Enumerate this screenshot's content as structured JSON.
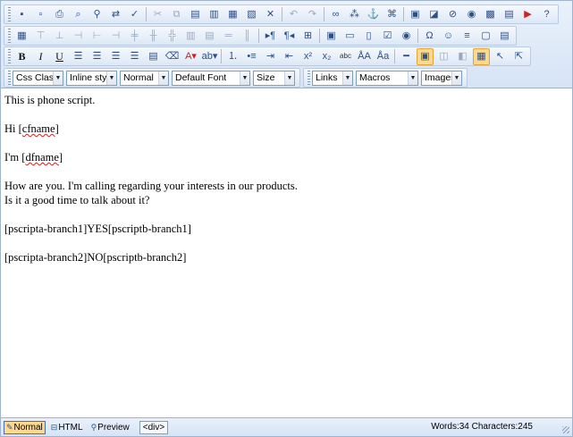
{
  "toolbar": {
    "row1": [
      {
        "name": "save-icon",
        "glyph": "▪"
      },
      {
        "name": "new-document-icon",
        "glyph": "▫"
      },
      {
        "name": "print-icon",
        "glyph": "⎙"
      },
      {
        "name": "preview-icon",
        "glyph": "⌕"
      },
      {
        "name": "find-icon",
        "glyph": "⚲"
      },
      {
        "name": "replace-icon",
        "glyph": "⇄"
      },
      {
        "name": "spellcheck-icon",
        "glyph": "✓"
      },
      {
        "sep": true
      },
      {
        "name": "cut-icon",
        "glyph": "✂",
        "dim": true
      },
      {
        "name": "copy-icon",
        "glyph": "⧉",
        "dim": true
      },
      {
        "name": "paste-icon",
        "glyph": "▤"
      },
      {
        "name": "paste-text-icon",
        "glyph": "▥"
      },
      {
        "name": "paste-word-icon",
        "glyph": "▦"
      },
      {
        "name": "paste-html-icon",
        "glyph": "▧"
      },
      {
        "name": "delete-icon",
        "glyph": "✕"
      },
      {
        "sep": true
      },
      {
        "name": "undo-icon",
        "glyph": "↶",
        "dim": true
      },
      {
        "name": "redo-icon",
        "glyph": "↷",
        "dim": true
      },
      {
        "sep": true
      },
      {
        "name": "insert-link-icon",
        "glyph": "∞"
      },
      {
        "name": "unlink-icon",
        "glyph": "⁂"
      },
      {
        "name": "anchor-icon",
        "glyph": "⚓"
      },
      {
        "name": "link-tree-icon",
        "glyph": "⌘"
      },
      {
        "sep": true
      },
      {
        "name": "insert-image-icon",
        "glyph": "▣"
      },
      {
        "name": "image-editor-icon",
        "glyph": "◪"
      },
      {
        "name": "flash-icon",
        "glyph": "⊘"
      },
      {
        "name": "media-icon",
        "glyph": "◉"
      },
      {
        "name": "document-icon",
        "glyph": "▩"
      },
      {
        "name": "template-icon",
        "glyph": "▤"
      },
      {
        "name": "youtube-icon",
        "glyph": "▶",
        "red": true
      },
      {
        "name": "help-icon",
        "glyph": "?"
      }
    ],
    "row2": [
      {
        "name": "insert-table-icon",
        "glyph": "▦"
      },
      {
        "name": "insert-row-above-icon",
        "glyph": "⊤",
        "dim": true
      },
      {
        "name": "insert-row-below-icon",
        "glyph": "⊥",
        "dim": true
      },
      {
        "name": "delete-row-icon",
        "glyph": "⊣",
        "dim": true
      },
      {
        "name": "insert-column-left-icon",
        "glyph": "⊢",
        "dim": true
      },
      {
        "name": "insert-column-right-icon",
        "glyph": "⊣",
        "dim": true
      },
      {
        "name": "delete-column-icon",
        "glyph": "╪",
        "dim": true
      },
      {
        "name": "merge-cells-icon",
        "glyph": "╫",
        "dim": true
      },
      {
        "name": "split-cells-icon",
        "glyph": "╬",
        "dim": true
      },
      {
        "name": "cell-props-icon",
        "glyph": "▥",
        "dim": true
      },
      {
        "name": "table-props-icon",
        "glyph": "▤",
        "dim": true
      },
      {
        "name": "row-props-icon",
        "glyph": "═",
        "dim": true
      },
      {
        "name": "column-props-icon",
        "glyph": "║",
        "dim": true
      },
      {
        "sep": true
      },
      {
        "name": "ltr-icon",
        "glyph": "▸¶"
      },
      {
        "name": "rtl-icon",
        "glyph": "¶◂"
      },
      {
        "name": "show-borders-icon",
        "glyph": "⊞"
      },
      {
        "sep": true
      },
      {
        "name": "form-icon",
        "glyph": "▣"
      },
      {
        "name": "textbox-icon",
        "glyph": "▭"
      },
      {
        "name": "textarea-icon",
        "glyph": "▯"
      },
      {
        "name": "checkbox-icon",
        "glyph": "☑"
      },
      {
        "name": "radio-icon",
        "glyph": "◉"
      },
      {
        "sep": true
      },
      {
        "name": "special-char-icon",
        "glyph": "Ω"
      },
      {
        "name": "emoticon-icon",
        "glyph": "☺"
      },
      {
        "name": "code-snippet-icon",
        "glyph": "≡"
      },
      {
        "name": "insert-box-icon",
        "glyph": "▢"
      },
      {
        "name": "date-icon",
        "glyph": "▤"
      }
    ],
    "row3": [
      {
        "name": "bold-icon",
        "glyph": "B",
        "style": "bold"
      },
      {
        "name": "italic-icon",
        "glyph": "I",
        "style": "ital"
      },
      {
        "name": "underline-icon",
        "glyph": "U",
        "style": "under"
      },
      {
        "name": "align-left-icon",
        "glyph": "☰"
      },
      {
        "name": "align-center-icon",
        "glyph": "☰"
      },
      {
        "name": "align-right-icon",
        "glyph": "☰"
      },
      {
        "name": "align-justify-icon",
        "glyph": "☰"
      },
      {
        "name": "align-none-icon",
        "glyph": "▤"
      },
      {
        "name": "eraser-icon",
        "glyph": "⌫"
      },
      {
        "name": "font-color-icon",
        "glyph": "A▾",
        "red": true
      },
      {
        "name": "highlight-color-icon",
        "glyph": "ab▾"
      },
      {
        "sep": true
      },
      {
        "name": "ordered-list-icon",
        "glyph": "⒈"
      },
      {
        "name": "unordered-list-icon",
        "glyph": "•≡"
      },
      {
        "name": "indent-icon",
        "glyph": "⇥"
      },
      {
        "name": "outdent-icon",
        "glyph": "⇤"
      },
      {
        "name": "superscript-icon",
        "glyph": "x²"
      },
      {
        "name": "subscript-icon",
        "glyph": "x₂"
      },
      {
        "name": "strikethrough-icon",
        "glyph": "abc",
        "tiny": true
      },
      {
        "name": "uppercase-icon",
        "glyph": "ÅA"
      },
      {
        "name": "lowercase-icon",
        "glyph": "Åa"
      },
      {
        "sep": true
      },
      {
        "name": "horizontal-rule-icon",
        "glyph": "━"
      },
      {
        "name": "insert-layer-icon",
        "glyph": "▣",
        "active": true
      },
      {
        "name": "bring-forward-icon",
        "glyph": "◫",
        "dim": true
      },
      {
        "name": "send-backward-icon",
        "glyph": "◧",
        "dim": true
      },
      {
        "name": "show-grid-icon",
        "glyph": "▦",
        "active": true
      },
      {
        "name": "select-icon",
        "glyph": "↖"
      },
      {
        "name": "pointer-icon",
        "glyph": "⇱"
      }
    ],
    "dropdowns1": [
      {
        "name": "css-class-dropdown",
        "value": "Css Class",
        "width": 57
      },
      {
        "name": "inline-style-dropdown",
        "value": "Inline style",
        "width": 57
      },
      {
        "name": "paragraph-dropdown",
        "value": "Normal",
        "width": 55
      },
      {
        "name": "font-dropdown",
        "value": "Default Font",
        "width": 88
      },
      {
        "name": "size-dropdown",
        "value": "Size",
        "width": 47
      }
    ],
    "dropdowns2": [
      {
        "name": "links-dropdown",
        "value": "Links",
        "width": 46
      },
      {
        "name": "macros-dropdown",
        "value": "Macros",
        "width": 70
      },
      {
        "name": "images-dropdown",
        "value": "Images",
        "width": 46
      }
    ]
  },
  "content": {
    "line1": "This is phone script.",
    "line2_prefix": "Hi [",
    "line2_word": "cfname",
    "line2_suffix": "]",
    "line3_prefix": "I'm [",
    "line3_word": "dfname",
    "line3_suffix": "]",
    "line4a": "How are you. I'm calling regarding your interests in our products.",
    "line4b": "Is it a good time to talk about it?",
    "line5": "[pscripta-branch1]YES[pscriptb-branch1]",
    "line6": "[pscripta-branch2]NO[pscriptb-branch2]"
  },
  "status": {
    "mode_normal": "Normal",
    "mode_html": "HTML",
    "mode_preview": "Preview",
    "tag": "<div>",
    "counts": "Words:34 Characters:245"
  }
}
